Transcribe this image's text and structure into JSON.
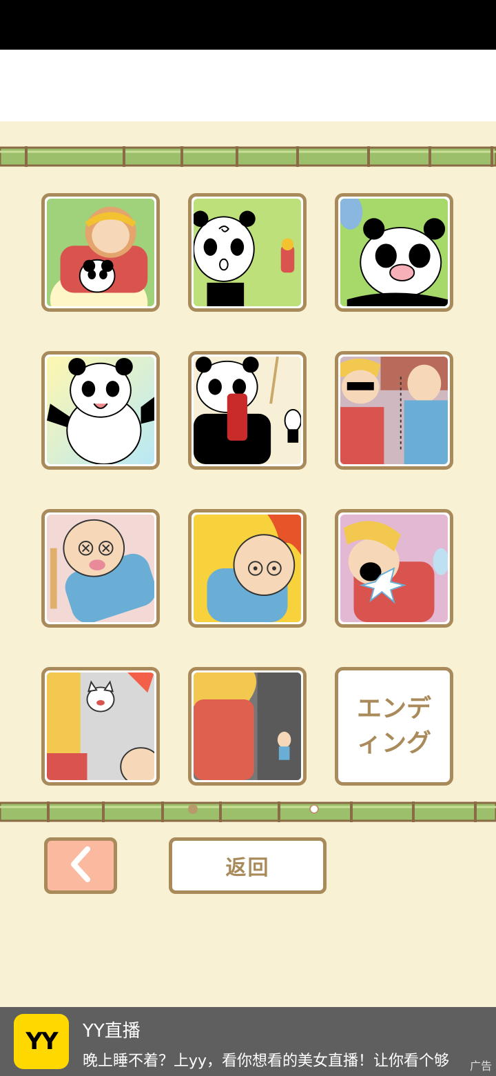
{
  "tiles": [
    {
      "id": "tile-1",
      "scene": "monkey-king-with-panda"
    },
    {
      "id": "tile-2",
      "scene": "dizzy-panda"
    },
    {
      "id": "tile-3",
      "scene": "crying-panda"
    },
    {
      "id": "tile-4",
      "scene": "happy-panda"
    },
    {
      "id": "tile-5",
      "scene": "panda-with-extinguisher"
    },
    {
      "id": "tile-6",
      "scene": "guard-and-stitched-man"
    },
    {
      "id": "tile-7",
      "scene": "knocked-out-old-man"
    },
    {
      "id": "tile-8",
      "scene": "old-man-in-fire"
    },
    {
      "id": "tile-9",
      "scene": "screaming-guard"
    },
    {
      "id": "tile-10",
      "scene": "angry-cat"
    },
    {
      "id": "tile-11",
      "scene": "guard-looking-down"
    }
  ],
  "ending": {
    "label": "エンディング"
  },
  "pagination": {
    "pages": 2,
    "current": 2
  },
  "buttons": {
    "back_icon": "chevron-left-icon",
    "return_label": "返回"
  },
  "ad": {
    "logo_text": "YY",
    "title": "YY直播",
    "description": "晚上睡不着？上yy，看你想看的美女直播！让你看个够",
    "tag": "广告"
  },
  "colors": {
    "background": "#f8f1d4",
    "frame": "#a98a5a",
    "back_button": "#fbb9a0",
    "bamboo": "#9bbf6a",
    "ad_bar": "#5f5f5f",
    "ad_logo": "#ffd800"
  }
}
